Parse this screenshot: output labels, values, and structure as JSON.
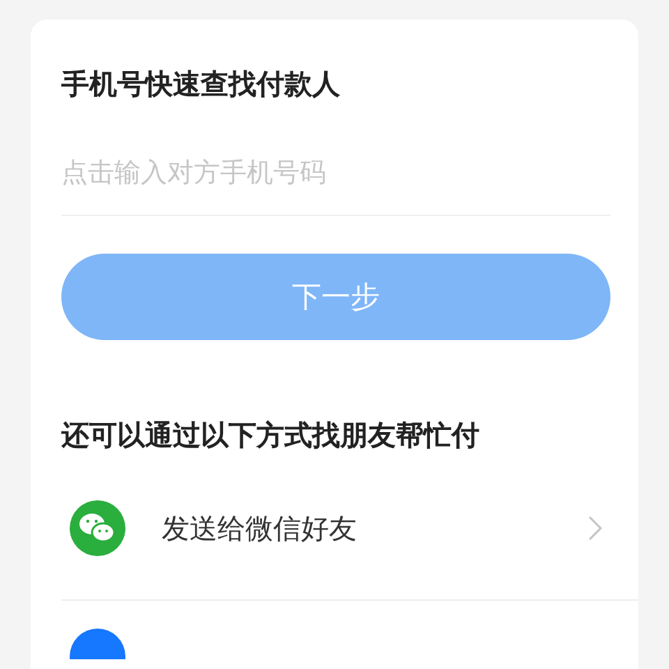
{
  "title": "手机号快速查找付款人",
  "phone_field": {
    "placeholder": "点击输入对方手机号码"
  },
  "next_button": {
    "label": "下一步",
    "disabled": true
  },
  "section_title": "还可以通过以下方式找朋友帮忙付",
  "options": [
    {
      "kind": "wechat",
      "label": "发送给微信好友"
    },
    {
      "kind": "alipay"
    }
  ]
}
